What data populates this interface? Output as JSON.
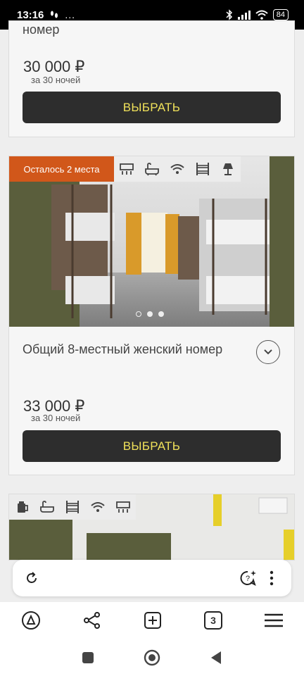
{
  "status_bar": {
    "time": "13:16",
    "extra": "...",
    "battery": "84"
  },
  "cards": [
    {
      "title_tail": "номер",
      "price": "30 000 ₽",
      "price_period": "за 30 ночей",
      "button_label": "ВЫБРАТЬ"
    },
    {
      "badge": "Осталось 2 места",
      "amenities": [
        "ac-icon",
        "bathtub-icon",
        "wifi-icon",
        "bunk-bed-icon",
        "lamp-icon"
      ],
      "title": "Общий 8-местный женский номер",
      "price": "33 000 ₽",
      "price_period": "за 30 ночей",
      "button_label": "ВЫБРАТЬ",
      "carousel_dots": 3,
      "carousel_active": 0
    },
    {
      "amenities": [
        "kettle-icon",
        "bathtub-icon",
        "bunk-bed-icon",
        "wifi-icon",
        "ac-icon"
      ]
    }
  ],
  "browser": {
    "tab_count": "3"
  },
  "colors": {
    "badge": "#d1571a",
    "button_bg": "#2d2d2d",
    "button_text": "#f0e15a"
  }
}
